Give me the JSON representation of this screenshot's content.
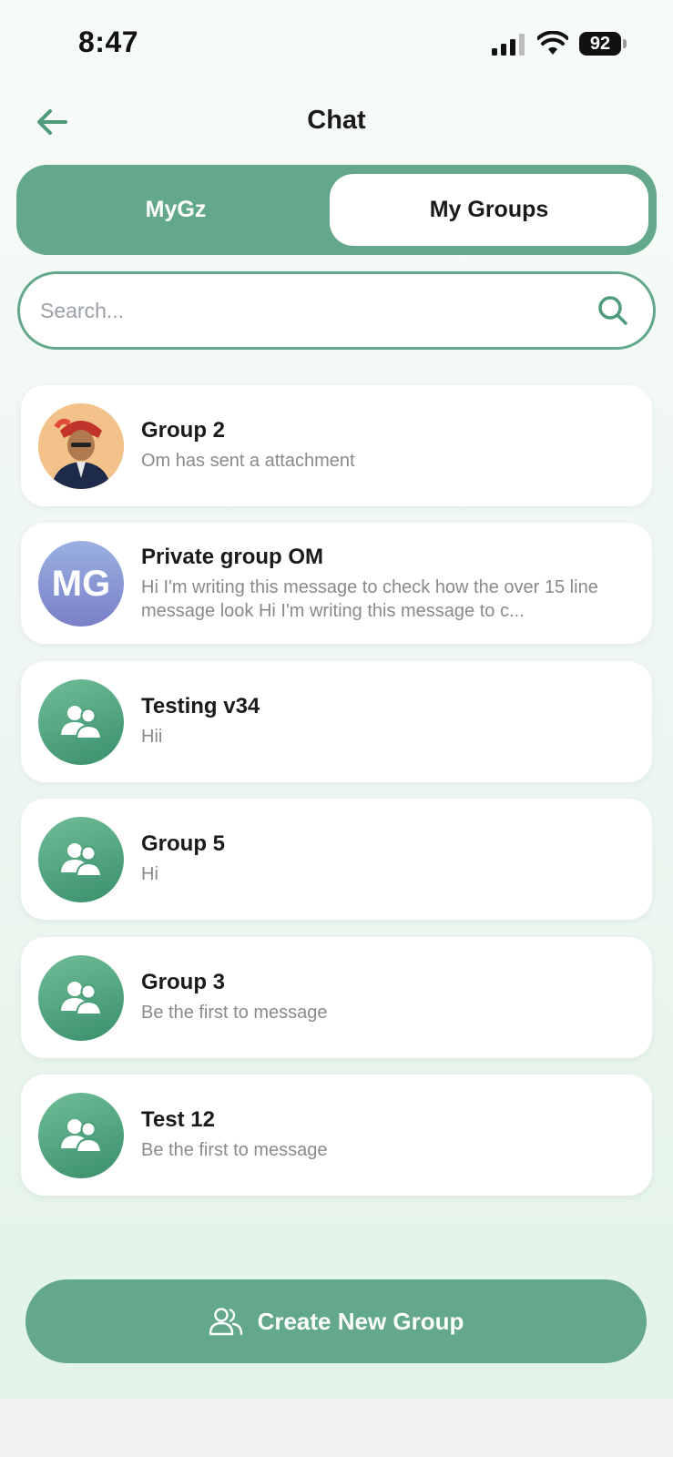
{
  "status_bar": {
    "time": "8:47",
    "battery": "92"
  },
  "header": {
    "title": "Chat",
    "back_icon": "arrow-left-icon"
  },
  "tabs": [
    {
      "label": "MyGz",
      "active": false
    },
    {
      "label": "My Groups",
      "active": true
    }
  ],
  "search": {
    "placeholder": "Search...",
    "value": "",
    "icon": "search-icon"
  },
  "groups": [
    {
      "name": "Group 2",
      "last_message": "Om has sent a attachment",
      "avatar": "photo"
    },
    {
      "name": "Private group OM",
      "last_message": "Hi I'm writing this message to check how the over 15 line message look Hi I'm writing this message to c...",
      "avatar": "initials",
      "initials": "MG"
    },
    {
      "name": "Testing v34",
      "last_message": "Hii",
      "avatar": "group-icon"
    },
    {
      "name": "Group 5",
      "last_message": "Hi",
      "avatar": "group-icon"
    },
    {
      "name": "Group 3",
      "last_message": "Be the first to message",
      "avatar": "group-icon"
    },
    {
      "name": "Test 12",
      "last_message": "Be the first to message",
      "avatar": "group-icon"
    }
  ],
  "create_button": {
    "label": "Create New Group",
    "icon": "users-icon"
  },
  "colors": {
    "accent": "#63a88a",
    "avatar_group": "#4a9f7a",
    "avatar_initials": "#8a94d4"
  }
}
